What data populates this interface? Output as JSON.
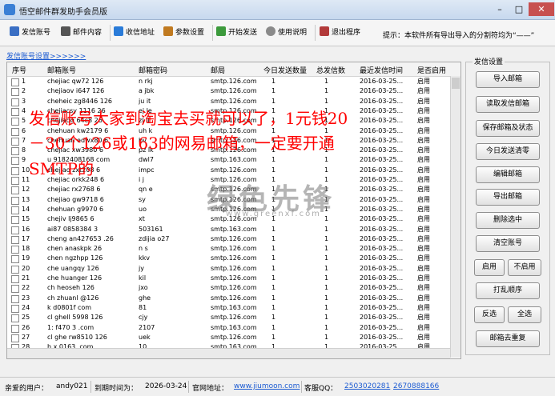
{
  "window": {
    "title": "悟空邮件群发助手会员版",
    "min": "–",
    "max": "□",
    "close": "✕"
  },
  "toolbar": {
    "items": [
      {
        "label": "发信账号",
        "icon": "account-icon",
        "color": "#3a6fc4"
      },
      {
        "label": "邮件内容",
        "icon": "pen-icon",
        "color": "#555555"
      },
      {
        "label": "收信地址",
        "icon": "address-book-icon",
        "color": "#2a7bd8"
      },
      {
        "label": "参数设置",
        "icon": "settings-icon",
        "color": "#c07a20"
      },
      {
        "label": "开始发送",
        "icon": "send-icon",
        "color": "#3c9a3c"
      },
      {
        "label": "使用说明",
        "icon": "help-icon",
        "color": "#8a8a8a"
      },
      {
        "label": "退出程序",
        "icon": "exit-icon",
        "color": "#b23a3a"
      }
    ],
    "hint": "提示：本软件所有导出导入的分割符均为“——”"
  },
  "account_group_label": "发信账号设置>>>>>>",
  "table": {
    "headers": [
      "序号",
      "邮箱账号",
      "邮箱密码",
      "邮局",
      "今日发送数量",
      "总发信数",
      "最近发信时间",
      "是否启用"
    ],
    "rows": [
      [
        "1",
        "chejiac  qw72   126",
        "n  rkj",
        "smtp.126.com",
        "1",
        "1",
        "2016-03-25...",
        "启用"
      ],
      [
        "2",
        "chejiaov  i647  126",
        "a  jbk",
        "smtp.126.com",
        "1",
        "1",
        "2016-03-25...",
        "启用"
      ],
      [
        "3",
        "cheheic  zg8446  126",
        "ju  it",
        "smtp.126.com",
        "1",
        "1",
        "2016-03-25...",
        "启用"
      ],
      [
        "4",
        "chejiacsy  1116   26",
        "ej  le",
        "smtp.126.com",
        "1",
        "1",
        "2016-03-25...",
        "启用"
      ],
      [
        "5",
        "chejiaqq  64c8   26",
        "zl  il",
        "smtp.126.com",
        "1",
        "1",
        "2016-03-25...",
        "启用"
      ],
      [
        "6",
        "chehuan  kw2179   6",
        "uh  k",
        "smtp.126.com",
        "1",
        "1",
        "2016-03-25...",
        "启用"
      ],
      [
        "7",
        "chehuan  edwx80   6",
        "bv  ",
        "smtp.126.com",
        "1",
        "1",
        "2016-03-25...",
        "启用"
      ],
      [
        "8",
        "chejiac  xw3980   6",
        "pz  lk",
        "smtp.126.com",
        "1",
        "1",
        "2016-03-25...",
        "启用"
      ],
      [
        "9",
        "u  9182408168  com",
        "dwl7",
        "smtp.163.com",
        "1",
        "1",
        "2016-03-25...",
        "启用"
      ],
      [
        "10",
        "chejiao  zxt208 6",
        "impc",
        "smtp.126.com",
        "1",
        "1",
        "2016-03-25...",
        "启用"
      ],
      [
        "11",
        "chejiac  orkk248 6",
        "i  j",
        "smtp.126.com",
        "1",
        "1",
        "2016-03-25...",
        "启用"
      ],
      [
        "12",
        "chejiac  rx2768 6",
        "qn  e",
        "smtp.126.com",
        "1",
        "1",
        "2016-03-25...",
        "启用"
      ],
      [
        "13",
        "chejiao  gw9718 6",
        "sy  ",
        "smtp.126.com",
        "1",
        "1",
        "2016-03-25...",
        "启用"
      ],
      [
        "14",
        "chehuan  g9970  6",
        "uo  ",
        "smtp.126.com",
        "1",
        "1",
        "2016-03-25...",
        "启用"
      ],
      [
        "15",
        "chejiv  lj9865  6",
        "xt",
        "smtp.126.com",
        "1",
        "1",
        "2016-03-25...",
        "启用"
      ],
      [
        "16",
        "ai87  0858384   3",
        "503161",
        "smtp.163.com",
        "1",
        "1",
        "2016-03-25...",
        "启用"
      ],
      [
        "17",
        "cheng  an427653 .26",
        "zdijia o27",
        "smtp.126.com",
        "1",
        "1",
        "2016-03-25...",
        "启用"
      ],
      [
        "18",
        "chen  anaskpk   26",
        "n  s",
        "smtp.126.com",
        "1",
        "1",
        "2016-03-25...",
        "启用"
      ],
      [
        "19",
        "chen  ngzhpp   126",
        "kkv",
        "smtp.126.com",
        "1",
        "1",
        "2016-03-25...",
        "启用"
      ],
      [
        "20",
        "che  uangqy  126",
        "jy  ",
        "smtp.126.com",
        "1",
        "1",
        "2016-03-25...",
        "启用"
      ],
      [
        "21",
        "che  huanger  126",
        "kil",
        "smtp.126.com",
        "1",
        "1",
        "2016-03-25...",
        "启用"
      ],
      [
        "22",
        "ch  heoseh   126",
        "jxo",
        "smtp.126.com",
        "1",
        "1",
        "2016-03-25...",
        "启用"
      ],
      [
        "23",
        "ch  zhuanl  @126",
        "ghe",
        "smtp.126.com",
        "1",
        "1",
        "2016-03-25...",
        "启用"
      ],
      [
        "24",
        "k  d0801f  com",
        "81",
        "smtp.163.com",
        "1",
        "1",
        "2016-03-25...",
        "启用"
      ],
      [
        "25",
        "cl  ghell  5998 126",
        "cjy",
        "smtp.126.com",
        "1",
        "1",
        "2016-03-25...",
        "启用"
      ],
      [
        "26",
        "1:  f470  3 .com",
        "2107",
        "smtp.163.com",
        "1",
        "1",
        "2016-03-25...",
        "启用"
      ],
      [
        "27",
        "cl  ghe   rw8510 126",
        "uek",
        "smtp.126.com",
        "1",
        "1",
        "2016-03-25...",
        "启用"
      ],
      [
        "28",
        "h  x  0163 .com",
        "10",
        "smtp.163.com",
        "1",
        "1",
        "2016-03-25...",
        "启用"
      ]
    ]
  },
  "side_panel": {
    "title": "发信设置",
    "buttons": [
      "导入邮箱",
      "读取发信邮箱",
      "保存邮箱及状态",
      "今日发送清零",
      "编辑邮箱",
      "导出邮箱",
      "删除选中",
      "清空账号",
      "启用",
      "不启用",
      "打乱顺序",
      "反选",
      "全选",
      "邮箱去重复"
    ]
  },
  "overlay_text": {
    "line1": "发信账号大家到淘宝去买就可以了，1元钱20",
    "line2": "－30个126或163的网易邮箱，一定要开通",
    "line3": "SMTP的"
  },
  "watermark": {
    "main": "绿色先锋",
    "sub": "www.greenxf.com"
  },
  "status": {
    "user_label": "亲爱的用户：",
    "user": "andy021",
    "expire_label": "到期时间为：",
    "expire": "2026-03-24",
    "site_label": "官网地址：",
    "site": "www.jiumoon.com",
    "qq_label": "客服QQ：",
    "qq1": "2503020281",
    "qq2": "2670888166"
  }
}
